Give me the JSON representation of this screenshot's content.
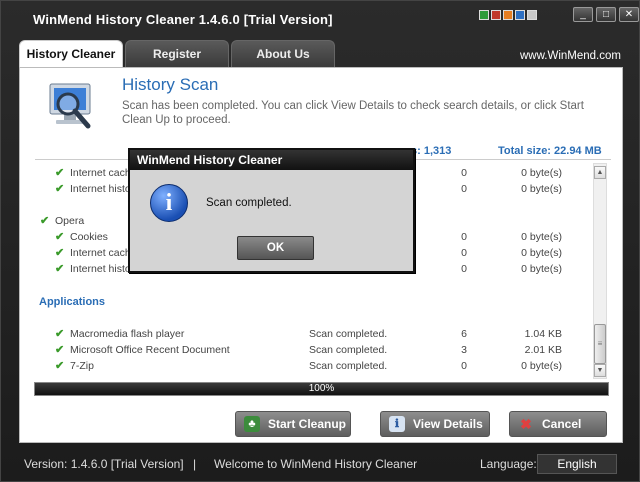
{
  "window": {
    "title": "WinMend History Cleaner 1.4.6.0 [Trial Version]",
    "skin_colors": [
      "#2e9b3a",
      "#c0392b",
      "#e67e22",
      "#2d6fc2",
      "#c9c9c9"
    ],
    "buttons": {
      "minimize": "_",
      "maximize": "□",
      "close": "✕"
    }
  },
  "tabs": [
    {
      "label": "History Cleaner",
      "active": true
    },
    {
      "label": "Register",
      "active": false
    },
    {
      "label": "About Us",
      "active": false
    }
  ],
  "site_link": "www.WinMend.com",
  "main": {
    "title": "History Scan",
    "description": "Scan has been completed. You can click View Details to check search details, or click Start Clean Up to proceed.",
    "summary_items": "s: 1,313",
    "summary_size": "Total size: 22.94 MB",
    "icon": "scan-computer-icon"
  },
  "results": {
    "rows": [
      {
        "name": "Internet cach",
        "status": "",
        "count": "0",
        "size": "0 byte(s)",
        "level": 1
      },
      {
        "name": "Internet histo",
        "status": "",
        "count": "0",
        "size": "0 byte(s)",
        "level": 1
      },
      {
        "name": "Opera",
        "status": "",
        "count": "",
        "size": "",
        "level": 0
      },
      {
        "name": "Cookies",
        "status": "",
        "count": "0",
        "size": "0 byte(s)",
        "level": 1
      },
      {
        "name": "Internet cach",
        "status": "",
        "count": "0",
        "size": "0 byte(s)",
        "level": 1
      },
      {
        "name": "Internet history",
        "status": "",
        "count": "0",
        "size": "0 byte(s)",
        "level": 1
      },
      {
        "name": "Macromedia flash player",
        "status": "Scan completed.",
        "count": "6",
        "size": "1.04 KB",
        "level": 1
      },
      {
        "name": "Microsoft Office Recent Document",
        "status": "Scan completed.",
        "count": "3",
        "size": "2.01 KB",
        "level": 1
      },
      {
        "name": "7-Zip",
        "status": "Scan completed.",
        "count": "0",
        "size": "0 byte(s)",
        "level": 1
      }
    ],
    "section_applications": "Applications"
  },
  "progress": {
    "value": 100,
    "label": "100%"
  },
  "actions": {
    "start_cleanup": "Start Cleanup",
    "view_details": "View Details",
    "cancel": "Cancel"
  },
  "status_bar": {
    "version": "Version:  1.4.6.0 [Trial Version]",
    "separator": "|",
    "welcome": "Welcome to WinMend History Cleaner",
    "language_label": "Language:",
    "language_value": "English"
  },
  "dialog": {
    "title": "WinMend History Cleaner",
    "message": "Scan completed.",
    "ok": "OK",
    "icon": "info-icon"
  }
}
